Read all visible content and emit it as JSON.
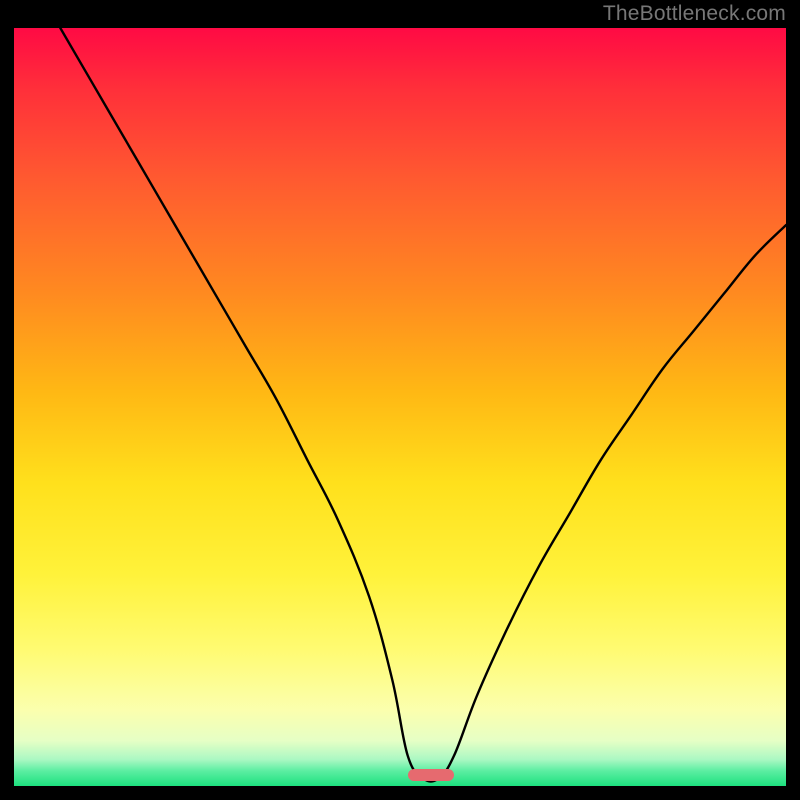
{
  "watermark": "TheBottleneck.com",
  "colors": {
    "frame_bg": "#000000",
    "curve_stroke": "#000000",
    "pill_fill": "#e66a6f",
    "watermark_text": "#777777"
  },
  "chart_data": {
    "type": "line",
    "title": "",
    "xlabel": "",
    "ylabel": "",
    "xlim": [
      0,
      100
    ],
    "ylim": [
      0,
      100
    ],
    "legend": false,
    "grid": false,
    "annotations": [
      {
        "kind": "pill",
        "x_center": 54,
        "y": 1.5,
        "width_x_units": 6,
        "color": "#e66a6f"
      }
    ],
    "series": [
      {
        "name": "bottleneck-curve",
        "comment": "Single black V-shaped curve. y ≈ 100 means top of plot, y ≈ 0 is bottom. Values estimated from pixel positions.",
        "x": [
          6,
          10,
          14,
          18,
          22,
          26,
          30,
          34,
          38,
          42,
          46,
          49,
          51,
          53,
          55,
          57,
          60,
          64,
          68,
          72,
          76,
          80,
          84,
          88,
          92,
          96,
          100
        ],
        "y": [
          100,
          93,
          86,
          79,
          72,
          65,
          58,
          51,
          43,
          35,
          25,
          14,
          4,
          1,
          1,
          4,
          12,
          21,
          29,
          36,
          43,
          49,
          55,
          60,
          65,
          70,
          74
        ]
      }
    ],
    "background_gradient_stops": [
      {
        "pos": 0.0,
        "color": "#ff0a44"
      },
      {
        "pos": 0.08,
        "color": "#ff2f3a"
      },
      {
        "pos": 0.2,
        "color": "#ff5a30"
      },
      {
        "pos": 0.35,
        "color": "#ff8a20"
      },
      {
        "pos": 0.48,
        "color": "#ffb814"
      },
      {
        "pos": 0.6,
        "color": "#ffe01c"
      },
      {
        "pos": 0.72,
        "color": "#fff23a"
      },
      {
        "pos": 0.82,
        "color": "#fffb72"
      },
      {
        "pos": 0.9,
        "color": "#fbffae"
      },
      {
        "pos": 0.94,
        "color": "#e6ffc5"
      },
      {
        "pos": 0.965,
        "color": "#abf8c3"
      },
      {
        "pos": 0.98,
        "color": "#5ceea2"
      },
      {
        "pos": 1.0,
        "color": "#1de07e"
      }
    ]
  }
}
